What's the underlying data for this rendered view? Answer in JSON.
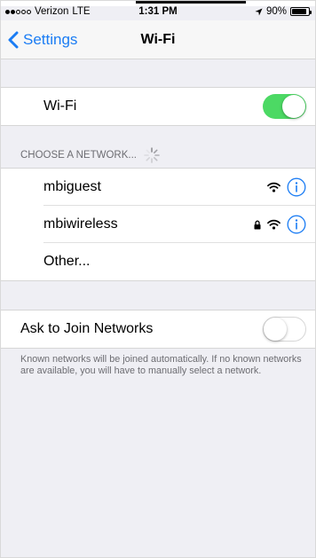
{
  "status_bar": {
    "carrier": "Verizon",
    "network": "LTE",
    "time": "1:31 PM",
    "battery": "90%",
    "battery_level": 0.9,
    "signal_bars_filled": 2,
    "signal_bars_total": 5
  },
  "nav": {
    "back_label": "Settings",
    "title": "Wi-Fi"
  },
  "wifi": {
    "label": "Wi-Fi",
    "enabled": true
  },
  "networks_section": {
    "header": "CHOOSE A NETWORK...",
    "networks": [
      {
        "name": "mbiguest",
        "locked": false
      },
      {
        "name": "mbiwireless",
        "locked": true
      }
    ],
    "other_label": "Other..."
  },
  "ask_to_join": {
    "label": "Ask to Join Networks",
    "enabled": false,
    "footer": "Known networks will be joined automatically. If no known networks are available, you will have to manually select a network."
  },
  "colors": {
    "accent": "#1a7cf4",
    "toggle_on": "#4cd964",
    "background": "#efeff4"
  },
  "icons": [
    "back-chevron-icon",
    "wifi-icon",
    "lock-icon",
    "info-icon",
    "spinner-icon",
    "location-arrow-icon",
    "battery-icon"
  ]
}
